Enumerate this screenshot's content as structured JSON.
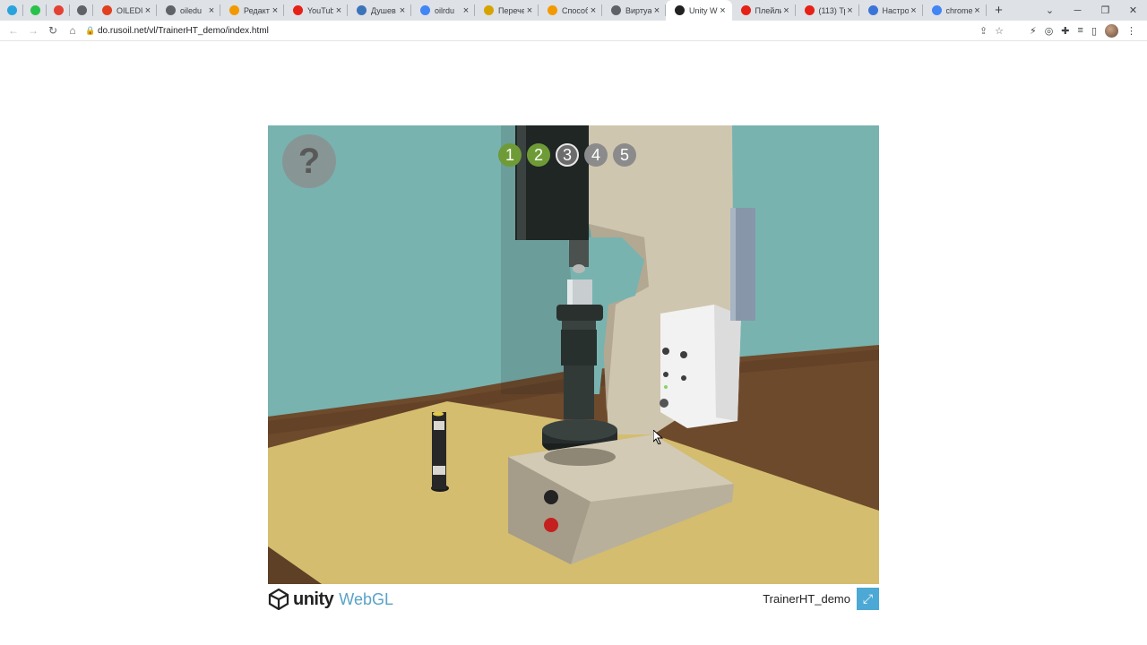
{
  "tabs": [
    {
      "type": "pinned",
      "icon": "telegram-icon",
      "color": "#2aa3dc",
      "title": ""
    },
    {
      "type": "pinned",
      "icon": "whatsapp-icon",
      "color": "#27c24c",
      "title": ""
    },
    {
      "type": "pinned",
      "icon": "gmail-icon",
      "color": "#e34133",
      "title": ""
    },
    {
      "type": "pinned",
      "icon": "globe-icon",
      "color": "#5f6368",
      "title": ""
    },
    {
      "type": "normal",
      "icon": "fire-icon",
      "color": "#e0401f",
      "title": "OILEDU"
    },
    {
      "type": "normal",
      "icon": "globe-icon",
      "color": "#5f6368",
      "title": "oiledu"
    },
    {
      "type": "normal",
      "icon": "document-icon",
      "color": "#f29900",
      "title": "Редакт"
    },
    {
      "type": "normal",
      "icon": "youtube-icon",
      "color": "#e62117",
      "title": "YouTub"
    },
    {
      "type": "normal",
      "icon": "vk-icon",
      "color": "#3b74b8",
      "title": "Душев"
    },
    {
      "type": "normal",
      "icon": "google-icon",
      "color": "#4285f4",
      "title": "oilrdu"
    },
    {
      "type": "normal",
      "icon": "document-icon",
      "color": "#d6a400",
      "title": "Перече"
    },
    {
      "type": "normal",
      "icon": "document-icon",
      "color": "#f29900",
      "title": "Способ"
    },
    {
      "type": "normal",
      "icon": "globe-icon",
      "color": "#5f6368",
      "title": "Виртуа"
    },
    {
      "type": "active",
      "icon": "unity-icon",
      "color": "#222222",
      "title": "Unity W"
    },
    {
      "type": "normal",
      "icon": "youtube-icon",
      "color": "#e62117",
      "title": "Плейли"
    },
    {
      "type": "normal",
      "icon": "youtube-icon",
      "color": "#e62117",
      "title": "(113) Тр"
    },
    {
      "type": "normal",
      "icon": "gear-icon",
      "color": "#3b74d8",
      "title": "Настро"
    },
    {
      "type": "normal",
      "icon": "google-icon",
      "color": "#4285f4",
      "title": "chrome"
    }
  ],
  "address": {
    "url": "do.rusoil.net/vl/TrainerHT_demo/index.html"
  },
  "game": {
    "help_glyph": "?",
    "steps": [
      {
        "label": "1",
        "state": "done"
      },
      {
        "label": "2",
        "state": "done"
      },
      {
        "label": "3",
        "state": "current"
      },
      {
        "label": "4",
        "state": "todo"
      },
      {
        "label": "5",
        "state": "todo"
      }
    ]
  },
  "footer": {
    "logo_word1": "unity",
    "logo_word2": "WebGL",
    "app_name": "TrainerHT_demo"
  }
}
